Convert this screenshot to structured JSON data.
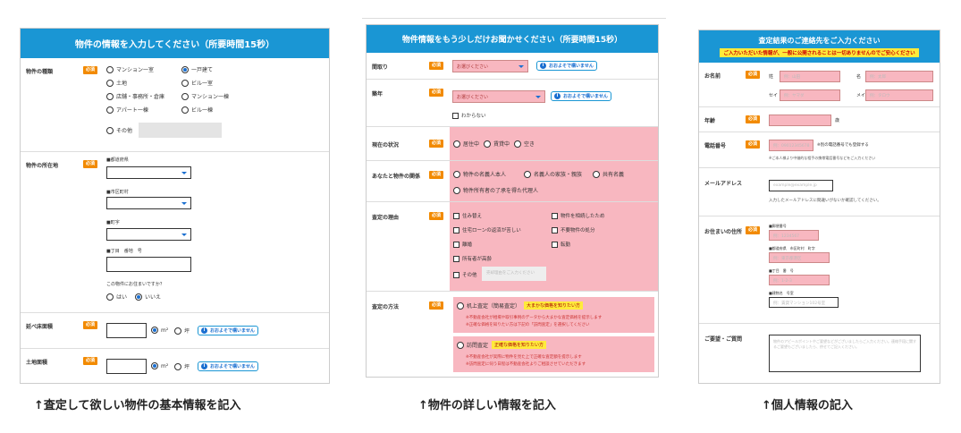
{
  "panel1": {
    "title": "物件の情報を入力してください（所要時間15秒）",
    "required": "必須",
    "type": {
      "label": "物件の種類",
      "options": [
        "マンション一室",
        "一戸建て",
        "土地",
        "ビル一室",
        "店舗・事務所・倉庫",
        "マンション一棟",
        "アパート一棟",
        "ビル一棟",
        "その他"
      ],
      "selected": "一戸建て"
    },
    "location": {
      "label": "物件の所在地",
      "pref": "■都道府県",
      "city": "■市区町村",
      "town": "■町字",
      "chome": "■丁目　番地　号",
      "question": "この物件にお住まいですか？",
      "yes": "はい",
      "no": "いいえ"
    },
    "floor_area": {
      "label": "延べ床面積",
      "unit1": "m²",
      "unit2": "坪",
      "ok": "おおよそで構いません"
    },
    "land_area": {
      "label": "土地面積",
      "unit1": "m²",
      "unit2": "坪",
      "ok": "おおよそで構いません"
    }
  },
  "panel2": {
    "title": "物件情報をもう少しだけお聞かせください（所要時間15秒）",
    "required": "必須",
    "layout": {
      "label": "間取り",
      "placeholder": "お選びください",
      "ok": "おおよそで構いません"
    },
    "age": {
      "label": "築年",
      "placeholder": "お選びください",
      "ok": "おおよそで構いません",
      "unknown": "わからない"
    },
    "status": {
      "label": "現在の状況",
      "options": [
        "居住中",
        "賃貸中",
        "空き"
      ]
    },
    "relation": {
      "label": "あなたと物件の関係",
      "options": [
        "物件の名義人本人",
        "名義人の家族・親族",
        "共有名義",
        "物件所有者の了承を得た代理人"
      ]
    },
    "reason": {
      "label": "査定の理由",
      "options": [
        "住み替え",
        "物件を相続したため",
        "住宅ローンの返済が苦しい",
        "不要物件の処分",
        "離婚",
        "転勤",
        "所有者が高齢",
        "その他"
      ],
      "other_placeholder": "売却理由をご入力ください"
    },
    "method": {
      "label": "査定の方法",
      "desk": "机上査定（簡易査定）",
      "desk_tag": "大まかな価格を知りたい方",
      "desk_note1": "※不動産会社が相場や取引事例のデータから大まかな査定価格を提示します",
      "desk_note2": "※正確な価格を知りたい方は下記の「訪問査定」を選択してください",
      "visit": "訪問査定",
      "visit_tag": "正確な価格を知りたい方",
      "visit_note1": "※不動産会社が実際に物件を見た上で正確な査定額を提示します",
      "visit_note2": "※訪問査定に伺う日程は不動産会社よりご相談させていただきます"
    }
  },
  "panel3": {
    "title": "査定結果のご連絡先をご入力ください",
    "notice": "ご入力いただいた情報が、一般に公開されることは一切ありませんのでご安心ください",
    "required": "必須",
    "name": {
      "label": "お名前",
      "sei": "姓",
      "mei": "名",
      "sei_kana": "セイ",
      "mei_kana": "メイ",
      "ph_sei": "例：山田",
      "ph_mei": "例：太郎",
      "ph_sei_kana": "例：ヤマダ",
      "ph_mei_kana": "例：タロウ"
    },
    "age": {
      "label": "年齢",
      "unit": "歳"
    },
    "phone": {
      "label": "電話番号",
      "placeholder": "例：09012345678",
      "note": "※別の電話番号でも登録する",
      "note2": "※ご本人様より中継的な相手の携帯電話番号などをご入力ください"
    },
    "email": {
      "label": "メールアドレス",
      "placeholder": "example@example.jp",
      "note": "入力したメールアドレスに間違いがないか確認してください。"
    },
    "address": {
      "label": "お住まいの住所",
      "zip": "■郵便番号",
      "pref": "■都道府県　市区町村　町字",
      "chome": "■丁目　番　号",
      "bldg": "■建物名　号室",
      "ph_zip": "例：1234567",
      "ph_pref": "例：東京都港区",
      "ph_chome": "例：1-2-3",
      "ph_bldg": "例：賃貸マンション102号室"
    },
    "request": {
      "label": "ご要望・ご質問",
      "placeholder": "物件のアピールポイントやご要望などがございましたらご入力ください。連絡手段に関するご要望もございましたら、併せてご記入ください。"
    }
  },
  "captions": [
    "↑査定して欲しい物件の基本情報を記入",
    "↑物件の詳しい情報を記入",
    "↑個人情報の記入"
  ]
}
